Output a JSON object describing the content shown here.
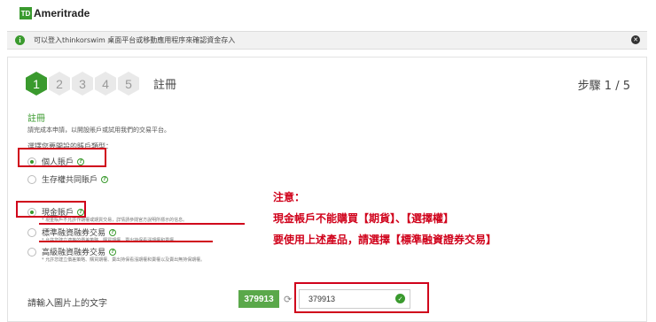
{
  "header": {
    "logo_mark": "TD",
    "logo_text": "Ameritrade"
  },
  "notice": {
    "info_icon": "info-icon",
    "text": "可以登入thinkorswim 桌面平台或移動應用程序來確認資金存入",
    "close_icon": "close-icon"
  },
  "steps": {
    "items": [
      "1",
      "2",
      "3",
      "4",
      "5"
    ],
    "active": 1,
    "title": "註冊",
    "count": "步驟 1 / 5"
  },
  "form": {
    "section_title": "註冊",
    "section_desc": "請完成本申請，以開設賬戶或試用我們的交易平台。",
    "question": "選擇您要開設的賬戶類型：",
    "account_types": [
      {
        "label": "個人賬戶",
        "checked": true
      },
      {
        "label": "生存權共同賬戶",
        "checked": false
      }
    ],
    "trading_types": [
      {
        "label": "現金賬戶",
        "checked": true,
        "note": "* 現金賬戶不允許作期權或期貨交易，詳情請參閱官方說明所標示的信息。"
      },
      {
        "label": "標準融資融券交易",
        "checked": false,
        "note": "* 允許您建立適格的價差策略、購買期權、賣出持保看漲期權和賣權。"
      },
      {
        "label": "高級融資融券交易",
        "checked": false,
        "note": "* 允許您建立價差策略、購買期權、賣出持保看漲期權和賣權以及賣出無持保期權。"
      }
    ],
    "captcha_label": "請輸入圖片上的文字",
    "captcha_image_text": "379913",
    "captcha_input_value": "379913"
  },
  "annotation": {
    "line1": "注意：",
    "line2": "現金帳戶不能購買【期貨】、【選擇權】",
    "line3": "要使用上述產品，請選擇【標準融資證券交易】"
  },
  "colors": {
    "brand_green": "#3a9a2e",
    "annotation_red": "#d0021b"
  }
}
